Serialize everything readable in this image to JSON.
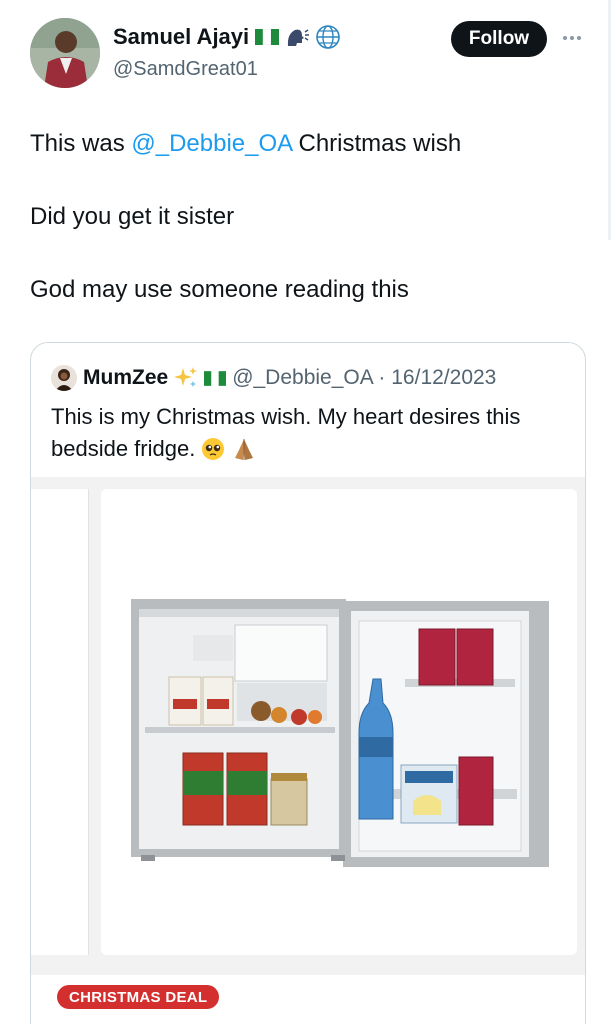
{
  "author": {
    "name": "Samuel Ajayi",
    "handle": "@SamdGreat01",
    "badges": [
      "nigeria-flag-icon",
      "speaking-head-icon",
      "globe-icon"
    ]
  },
  "follow_button": "Follow",
  "tweet": {
    "line1_prefix": "This was ",
    "line1_mention": "@_Debbie_OA",
    "line1_suffix": " Christmas wish",
    "line2": "Did you get it sister",
    "line3": "God may use someone reading this"
  },
  "quoted": {
    "name": "MumZee",
    "handle_and_date": "@_Debbie_OA · 16/12/2023",
    "text_line1": "This is my Christmas wish.  My heart desires this",
    "text_line2": "bedside fridge.",
    "emojis": [
      "pleading-face-icon",
      "folded-hands-icon"
    ],
    "badge": "CHRISTMAS DEAL"
  },
  "colors": {
    "link": "#1d9bf0",
    "muted": "#536471",
    "deal_badge": "#d32f2f"
  }
}
